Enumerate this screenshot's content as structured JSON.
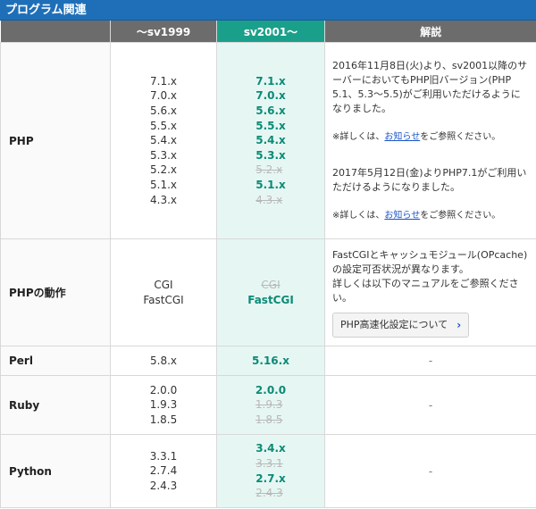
{
  "title": "プログラム関連",
  "headers": [
    "",
    "〜sv1999",
    "sv2001〜",
    "解説"
  ],
  "rows": {
    "php": {
      "label": "PHP",
      "old": [
        "7.1.x",
        "7.0.x",
        "5.6.x",
        "5.5.x",
        "5.4.x",
        "5.3.x",
        "5.2.x",
        "5.1.x",
        "4.3.x"
      ],
      "new": [
        {
          "v": "7.1.x",
          "strike": false
        },
        {
          "v": "7.0.x",
          "strike": false
        },
        {
          "v": "5.6.x",
          "strike": false
        },
        {
          "v": "5.5.x",
          "strike": false
        },
        {
          "v": "5.4.x",
          "strike": false
        },
        {
          "v": "5.3.x",
          "strike": false
        },
        {
          "v": "5.2.x",
          "strike": true
        },
        {
          "v": "5.1.x",
          "strike": false
        },
        {
          "v": "4.3.x",
          "strike": true
        }
      ],
      "note1_line1": "2016年11月8日(火)より、sv2001以降のサ",
      "note1_line2": "ーバーにおいてもPHP旧バージョン(PHP",
      "note1_line3": "5.1、5.3〜5.5)がご利用いただけるように",
      "note1_line4": "なりました。",
      "detail_prefix": "※詳しくは、",
      "detail_link": "お知らせ",
      "detail_suffix": "をご参照ください。",
      "note2_line1": "2017年5月12日(金)よりPHP7.1がご利用い",
      "note2_line2": "ただけるようになりました。"
    },
    "php_mode": {
      "label": "PHPの動作",
      "old": [
        "CGI",
        "FastCGI"
      ],
      "new": [
        {
          "v": "CGI",
          "strike": true
        },
        {
          "v": "FastCGI",
          "strike": false
        }
      ],
      "note_line1": "FastCGIとキャッシュモジュール(OPcache)",
      "note_line2": "の設定可否状況が異なります。",
      "note_line3": "詳しくは以下のマニュアルをご参照くださ",
      "note_line4": "い。",
      "button_label": "PHP高速化設定について"
    },
    "perl": {
      "label": "Perl",
      "old": [
        "5.8.x"
      ],
      "new": [
        {
          "v": "5.16.x",
          "strike": false
        }
      ],
      "note": "-"
    },
    "ruby": {
      "label": "Ruby",
      "old": [
        "2.0.0",
        "1.9.3",
        "1.8.5"
      ],
      "new": [
        {
          "v": "2.0.0",
          "strike": false
        },
        {
          "v": "1.9.3",
          "strike": true
        },
        {
          "v": "1.8.5",
          "strike": true
        }
      ],
      "note": "-"
    },
    "python": {
      "label": "Python",
      "old": [
        "3.3.1",
        "2.7.4",
        "2.4.3"
      ],
      "new": [
        {
          "v": "3.4.x",
          "strike": false
        },
        {
          "v": "3.3.1",
          "strike": true
        },
        {
          "v": "2.7.x",
          "strike": false
        },
        {
          "v": "2.4.3",
          "strike": true
        }
      ],
      "note": "-"
    }
  },
  "colors": {
    "title_bg": "#1f6fb8",
    "header_old_bg": "#6c6c6c",
    "header_new_bg": "#1aa08a",
    "new_col_bg": "#e6f7f3",
    "new_text": "#0c8a76",
    "link": "#1a55c8"
  }
}
